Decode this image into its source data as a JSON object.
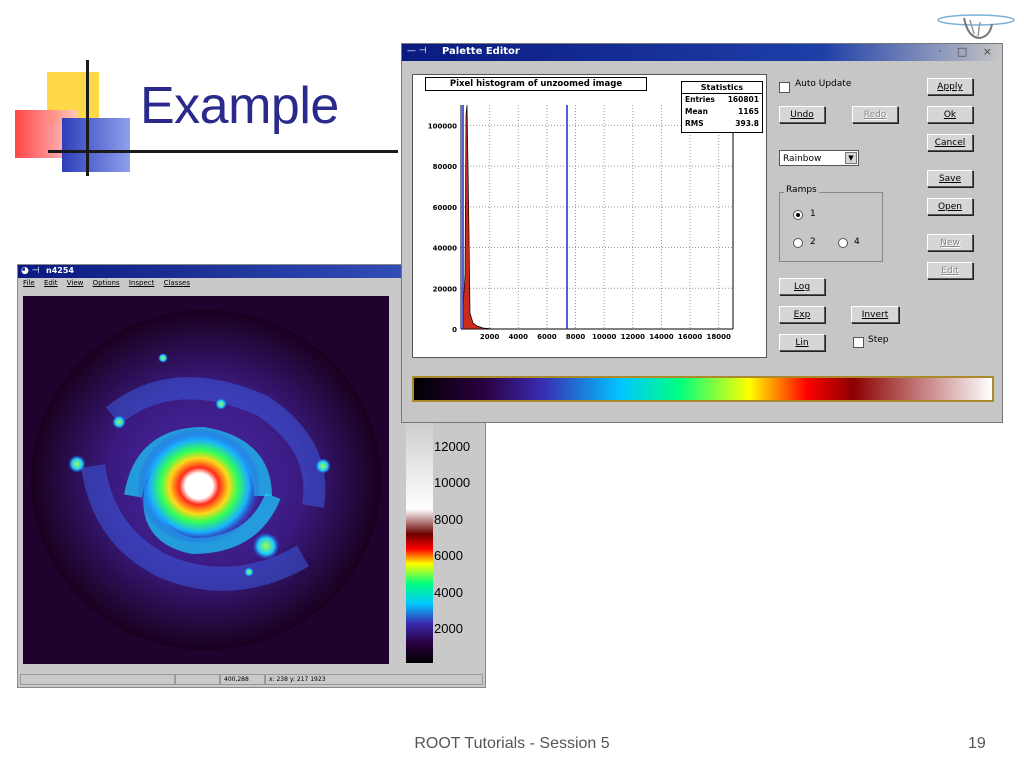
{
  "slide": {
    "title": "Example",
    "footer": "ROOT Tutorials - Session 5",
    "page_number": "19"
  },
  "image_window": {
    "title": "n4254",
    "menu": [
      "File",
      "Edit",
      "View",
      "Options",
      "Inspect",
      "Classes"
    ],
    "palette_axis_labels": [
      "12000",
      "10000",
      "8000",
      "6000",
      "4000",
      "2000"
    ],
    "status": {
      "coords": "400,288",
      "readout": "x: 238  y: 217   1923"
    }
  },
  "palette_editor": {
    "title": "Palette Editor",
    "histogram": {
      "title": "Pixel histogram of unzoomed image",
      "stats": {
        "header": "Statistics",
        "entries_label": "Entries",
        "entries": "160801",
        "mean_label": "Mean",
        "mean": "1165",
        "rms_label": "RMS",
        "rms": "393.8"
      },
      "y_ticks": [
        "100000",
        "80000",
        "60000",
        "40000",
        "20000",
        "0"
      ],
      "x_ticks": [
        "2000",
        "4000",
        "6000",
        "8000",
        "10000",
        "12000",
        "14000",
        "16000",
        "18000"
      ]
    },
    "auto_update_label": "Auto Update",
    "step_label": "Step",
    "palette_select": "Rainbow",
    "ramps_label": "Ramps",
    "ramp_options": [
      "1",
      "2",
      "4"
    ],
    "buttons": {
      "apply": "Apply",
      "ok": "Ok",
      "cancel": "Cancel",
      "save": "Save",
      "open": "Open",
      "new": "New",
      "edit": "Edit",
      "undo": "Undo",
      "redo": "Redo",
      "log": "Log",
      "exp": "Exp",
      "lin": "Lin",
      "invert": "Invert"
    }
  },
  "colors": {
    "title_text": "#2a2a8c",
    "titlebar": "#0a1a80",
    "histogram_fill": "#cc2a1a",
    "range_line": "#1a2ad0"
  }
}
